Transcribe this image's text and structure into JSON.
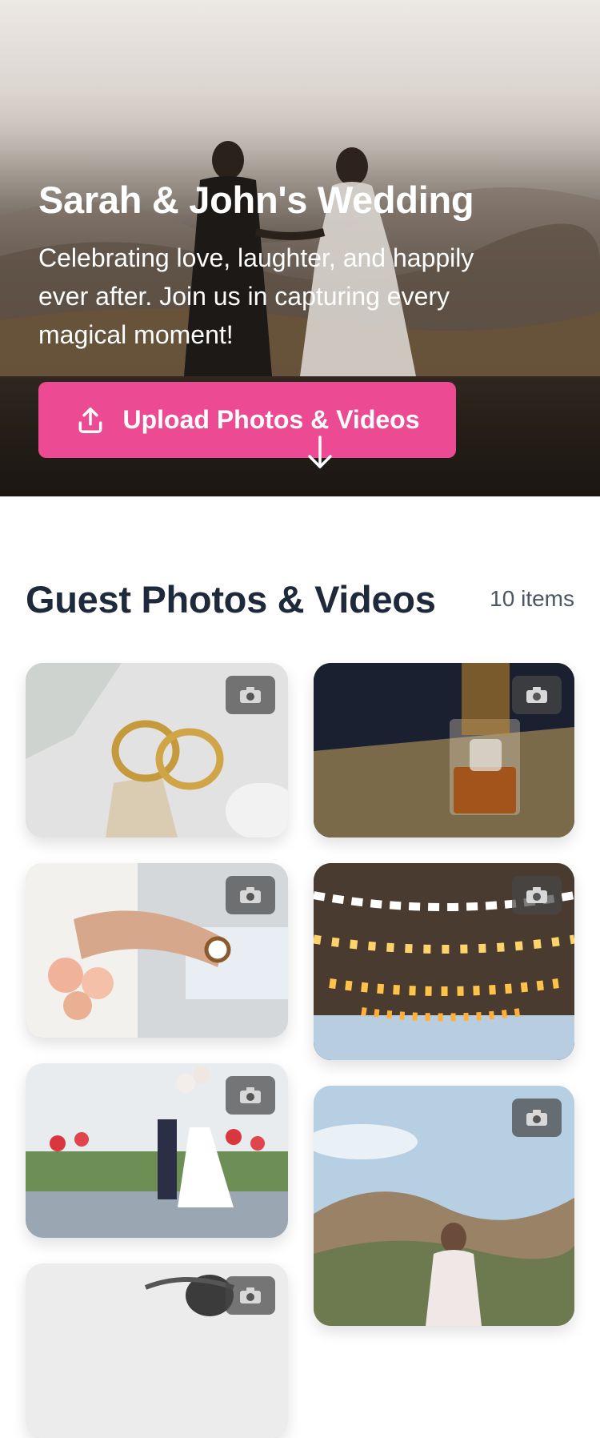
{
  "hero": {
    "title": "Sarah & John's Wedding",
    "subtitle": "Celebrating love, laughter, and happily ever after. Join us in capturing every magical moment!",
    "upload_label": "Upload Photos & Videos",
    "upload_icon": "upload-icon",
    "scroll_icon": "arrow-down-icon",
    "accent_color": "#ec4b93"
  },
  "gallery": {
    "title": "Guest Photos & Videos",
    "count_label": "10 items",
    "tiles": [
      {
        "subject": "wedding-rings",
        "badge_icon": "camera-icon"
      },
      {
        "subject": "cocktail-glass",
        "badge_icon": "camera-icon"
      },
      {
        "subject": "holding-hands-bouquet",
        "badge_icon": "camera-icon"
      },
      {
        "subject": "string-lights",
        "badge_icon": "camera-icon"
      },
      {
        "subject": "ceremony-balloons",
        "badge_icon": "camera-icon"
      },
      {
        "subject": "bride-mountains",
        "badge_icon": "camera-icon"
      },
      {
        "subject": "black-and-white-couple",
        "badge_icon": "camera-icon"
      }
    ]
  }
}
